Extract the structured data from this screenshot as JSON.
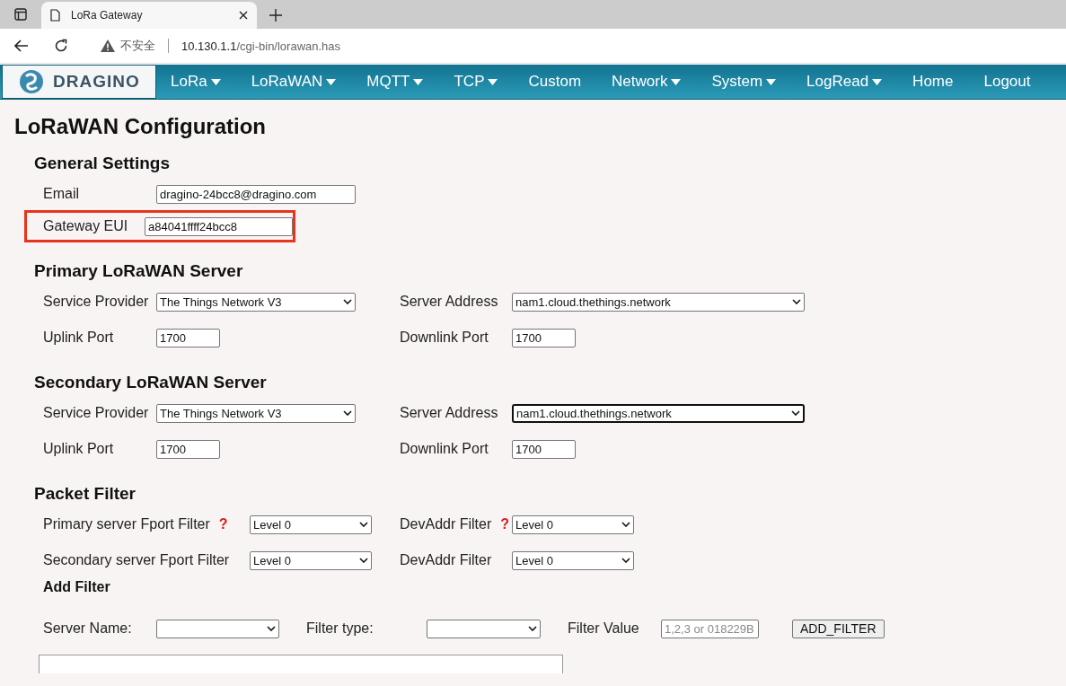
{
  "browser": {
    "tab_title": "LoRa Gateway",
    "security_label": "不安全",
    "url_host": "10.130.1.1",
    "url_path": "/cgi-bin/lorawan.has"
  },
  "nav": {
    "logo_text": "DRAGINO",
    "items": [
      {
        "label": "LoRa",
        "dropdown": true
      },
      {
        "label": "LoRaWAN",
        "dropdown": true
      },
      {
        "label": "MQTT",
        "dropdown": true
      },
      {
        "label": "TCP",
        "dropdown": true
      },
      {
        "label": "Custom",
        "dropdown": false
      },
      {
        "label": "Network",
        "dropdown": true
      },
      {
        "label": "System",
        "dropdown": true
      },
      {
        "label": "LogRead",
        "dropdown": true
      },
      {
        "label": "Home",
        "dropdown": false
      },
      {
        "label": "Logout",
        "dropdown": false
      }
    ]
  },
  "page_title": "LoRaWAN Configuration",
  "sections": [
    {
      "title": "General Settings",
      "rows": [
        [
          {
            "label": "Email",
            "kind": "text",
            "value": "dragino-24bcc8@dragino.com",
            "highlighted": false
          }
        ],
        [
          {
            "label": "Gateway EUI",
            "kind": "text",
            "value": "a84041ffff24bcc8",
            "highlighted": true
          }
        ]
      ]
    },
    {
      "title": "Primary LoRaWAN Server",
      "rows": [
        [
          {
            "label": "Service Provider",
            "kind": "select",
            "value": "The Things Network V3",
            "focused": false
          },
          {
            "label": "Server Address",
            "kind": "select",
            "value": "nam1.cloud.thethings.network",
            "focused": false
          }
        ],
        [
          {
            "label": "Uplink Port",
            "kind": "text",
            "value": "1700"
          },
          {
            "label": "Downlink Port",
            "kind": "text",
            "value": "1700"
          }
        ]
      ]
    },
    {
      "title": "Secondary LoRaWAN Server",
      "rows": [
        [
          {
            "label": "Service Provider",
            "kind": "select",
            "value": "The Things Network V3",
            "focused": false
          },
          {
            "label": "Server Address",
            "kind": "select",
            "value": "nam1.cloud.thethings.network",
            "focused": true
          }
        ],
        [
          {
            "label": "Uplink Port",
            "kind": "text",
            "value": "1700"
          },
          {
            "label": "Downlink Port",
            "kind": "text",
            "value": "1700"
          }
        ]
      ]
    },
    {
      "title": "Packet Filter",
      "rows": [
        [
          {
            "label": "Primary server Fport Filter",
            "kind": "select",
            "value": "Level 0",
            "help": "?"
          },
          {
            "label": "DevAddr Filter",
            "kind": "select",
            "value": "Level 0",
            "help": "?"
          }
        ],
        [
          {
            "label": "Secondary server Fport Filter",
            "kind": "select",
            "value": "Level 0"
          },
          {
            "label": "DevAddr Filter",
            "kind": "select",
            "value": "Level 0"
          }
        ]
      ]
    }
  ],
  "add_filter": {
    "title": "Add Filter",
    "fields": [
      {
        "label": "Server Name:",
        "kind": "select"
      },
      {
        "label": "Filter type:",
        "kind": "select"
      },
      {
        "label": "Filter Value",
        "kind": "text",
        "placeholder": "1,2,3 or 018229B"
      }
    ],
    "button": "ADD_FILTER"
  }
}
